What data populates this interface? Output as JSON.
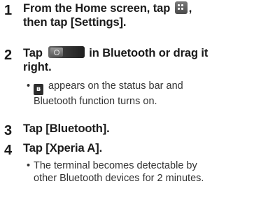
{
  "steps": [
    {
      "number": "1",
      "title_line1_before": "From the Home screen, tap",
      "title_line1_after": ",",
      "title_line2": "then tap [Settings].",
      "icon": "apps-grid-icon"
    },
    {
      "number": "2",
      "title_before": "Tap",
      "title_after": "in Bluetooth or drag it",
      "title_line2": "right.",
      "icon": "toggle-off-icon",
      "bullet_line1_after_icon": "appears on the status bar and",
      "bullet_line2": "Bluetooth function turns on.",
      "bullet_icon": "bluetooth-status-icon"
    },
    {
      "number": "3",
      "title": "Tap [Bluetooth]."
    },
    {
      "number": "4",
      "title": "Tap [Xperia A].",
      "bullet_line1": "The terminal becomes detectable by",
      "bullet_line2": "other Bluetooth devices for 2 minutes."
    }
  ],
  "bullet_symbol": "•",
  "bluetooth_glyph": "ʙ"
}
